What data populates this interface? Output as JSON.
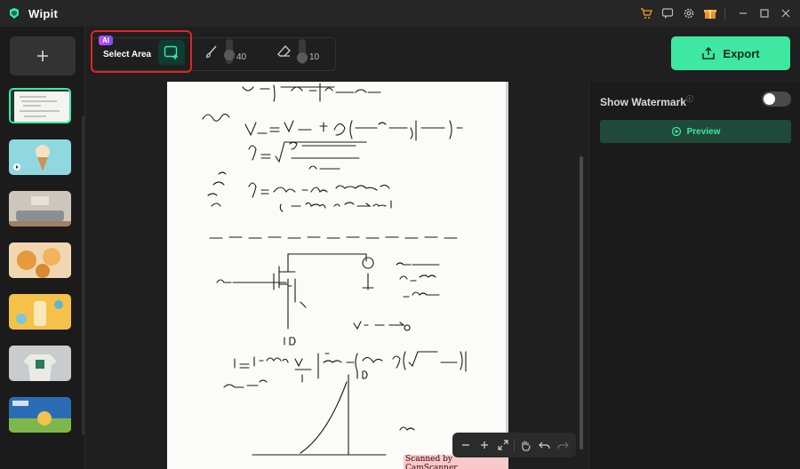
{
  "app": {
    "title": "Wipit"
  },
  "titlebar": {
    "icons": [
      "cart-icon",
      "feedback-icon",
      "settings-icon",
      "gift-icon",
      "minimize-icon",
      "maximize-icon",
      "close-icon"
    ]
  },
  "left_rail": {
    "add_icon": "plus-icon",
    "thumbnails": [
      {
        "name": "thumb-handwritten-notes",
        "selected": true
      },
      {
        "name": "thumb-ice-cream-video",
        "selected": false
      },
      {
        "name": "thumb-living-room",
        "selected": false
      },
      {
        "name": "thumb-cupcakes",
        "selected": false
      },
      {
        "name": "thumb-smoothie",
        "selected": false
      },
      {
        "name": "thumb-tshirt-model",
        "selected": false
      },
      {
        "name": "thumb-wipit-promo",
        "selected": false
      }
    ]
  },
  "toolbar": {
    "ai_badge": "AI",
    "select_area_label": "Select Area",
    "brush_value": "40",
    "eraser_value": "10",
    "export_label": "Export"
  },
  "right_panel": {
    "watermark_label": "Show Watermark",
    "watermark_info": "ⓘ",
    "watermark_on": false,
    "preview_label": "Preview"
  },
  "document": {
    "footer_stamp": "Scanned by CamScanner"
  },
  "colors": {
    "accent": "#3ee8a0",
    "highlight_red": "#e02424",
    "bg": "#1f1f1f"
  }
}
